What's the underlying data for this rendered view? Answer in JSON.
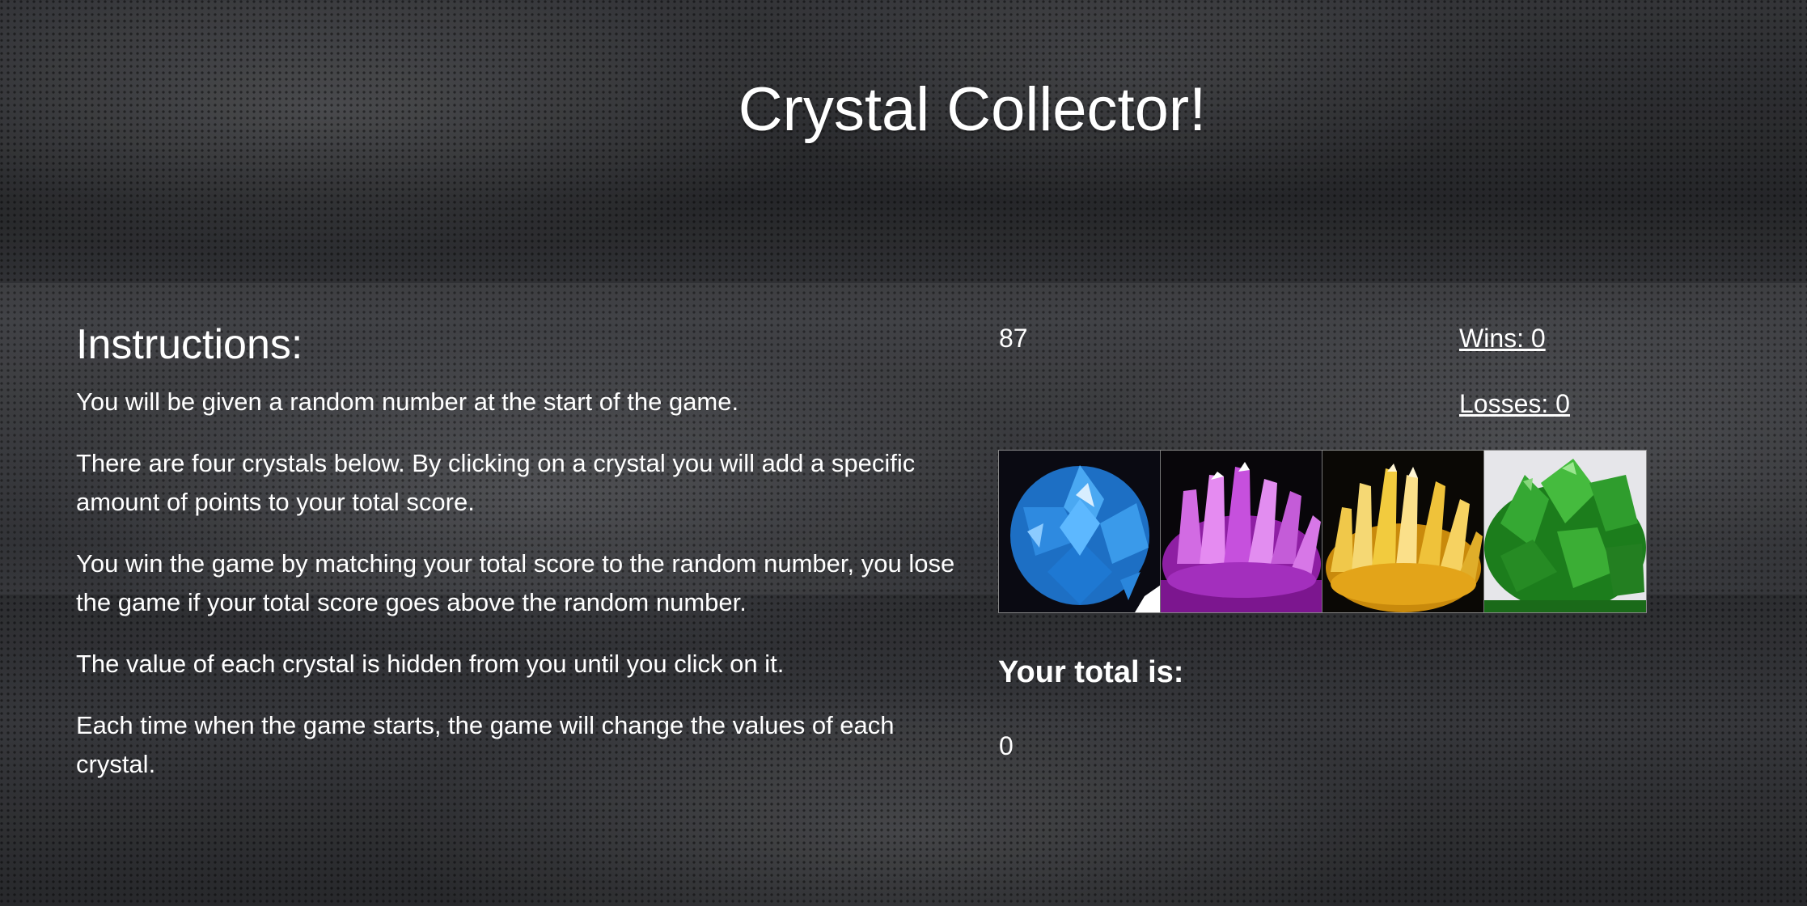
{
  "title": "Crystal Collector!",
  "instructions": {
    "heading": "Instructions:",
    "paragraphs": [
      "You will be given a random number at the start of the game.",
      "There are four crystals below. By clicking on a crystal you will add a specific amount of points to your total score.",
      "You win the game by matching your total score to the random number, you lose the game if your total score goes above the random number.",
      "The value of each crystal is hidden from you until you click on it.",
      "Each time when the game starts, the game will change the values of each crystal."
    ]
  },
  "game": {
    "target_number": "87",
    "wins": "Wins: 0",
    "losses": "Losses: 0",
    "total_label": "Your total is:",
    "total_value": "0"
  },
  "crystals": [
    {
      "name": "blue-crystal",
      "color": "#2f8fe6"
    },
    {
      "name": "purple-crystal",
      "color": "#c43bd6"
    },
    {
      "name": "yellow-crystal",
      "color": "#e8b628"
    },
    {
      "name": "green-crystal",
      "color": "#2fa62c"
    }
  ],
  "colors": {
    "text": "#ffffff",
    "background": "#2c2d30"
  }
}
